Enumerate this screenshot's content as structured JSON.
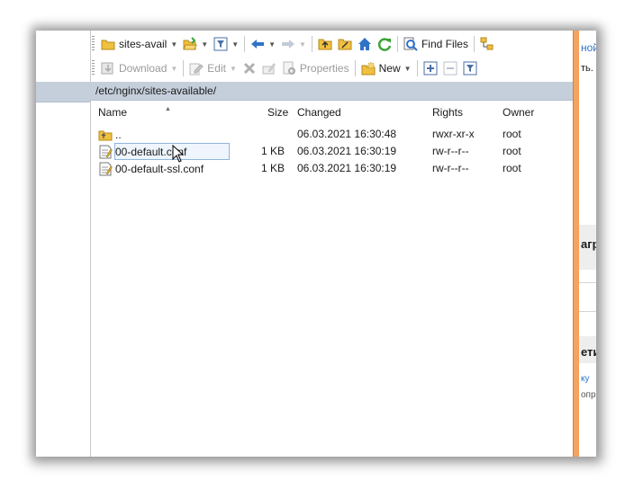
{
  "toolbar1": {
    "location_label": "sites-avail",
    "find_files_label": "Find Files"
  },
  "toolbar2": {
    "download_label": "Download",
    "edit_label": "Edit",
    "properties_label": "Properties",
    "new_label": "New"
  },
  "path": "/etc/nginx/sites-available/",
  "columns": {
    "name": "Name",
    "size": "Size",
    "changed": "Changed",
    "rights": "Rights",
    "owner": "Owner"
  },
  "files": [
    {
      "name": "..",
      "size": "",
      "changed": "06.03.2021 16:30:48",
      "rights": "rwxr-xr-x",
      "owner": "root",
      "type": "parent-folder"
    },
    {
      "name": "00-default.conf",
      "size": "1 KB",
      "changed": "06.03.2021 16:30:19",
      "rights": "rw-r--r--",
      "owner": "root",
      "type": "file",
      "selected": true
    },
    {
      "name": "00-default-ssl.conf",
      "size": "1 KB",
      "changed": "06.03.2021 16:30:19",
      "rights": "rw-r--r--",
      "owner": "root",
      "type": "file"
    }
  ],
  "background_page": {
    "fragments": [
      "ной",
      "ть.",
      "агру",
      "ети",
      "ку",
      "опр"
    ]
  },
  "colors": {
    "path_bar": "#c5cfdc",
    "selection": "#eef5fc",
    "accent_bar": "#f4a460",
    "folder": "#f0c040",
    "nav_arrow": "#2f73c8",
    "refresh": "#3aa335"
  }
}
